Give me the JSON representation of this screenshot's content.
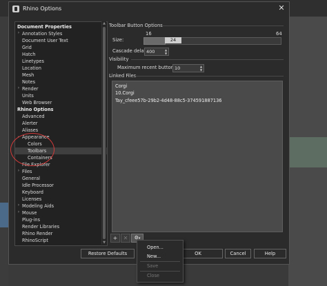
{
  "window": {
    "title": "Rhino Options"
  },
  "tree": {
    "items": [
      {
        "label": "Document Properties",
        "bold": true,
        "indent": 0
      },
      {
        "label": "Annotation Styles",
        "expandable": true,
        "indent": 1
      },
      {
        "label": "Document User Text",
        "indent": 1
      },
      {
        "label": "Grid",
        "indent": 1
      },
      {
        "label": "Hatch",
        "indent": 1
      },
      {
        "label": "Linetypes",
        "indent": 1
      },
      {
        "label": "Location",
        "indent": 1
      },
      {
        "label": "Mesh",
        "indent": 1
      },
      {
        "label": "Notes",
        "indent": 1
      },
      {
        "label": "Render",
        "expandable": true,
        "indent": 1
      },
      {
        "label": "Units",
        "indent": 1
      },
      {
        "label": "Web Browser",
        "indent": 1
      },
      {
        "label": "Rhino Options",
        "bold": true,
        "indent": 0
      },
      {
        "label": "Advanced",
        "indent": 1
      },
      {
        "label": "Alerter",
        "indent": 1
      },
      {
        "label": "Aliases",
        "indent": 1
      },
      {
        "label": "Appearance",
        "expanded": true,
        "indent": 1
      },
      {
        "label": "Colors",
        "indent": 2
      },
      {
        "label": "Toolbars",
        "indent": 2,
        "selected": true
      },
      {
        "label": "Containers",
        "indent": 2
      },
      {
        "label": "File Explorer",
        "indent": 1
      },
      {
        "label": "Files",
        "expandable": true,
        "indent": 1
      },
      {
        "label": "General",
        "indent": 1
      },
      {
        "label": "Idle Processor",
        "indent": 1
      },
      {
        "label": "Keyboard",
        "indent": 1
      },
      {
        "label": "Licenses",
        "indent": 1
      },
      {
        "label": "Modeling Aids",
        "expandable": true,
        "indent": 1
      },
      {
        "label": "Mouse",
        "expandable": true,
        "indent": 1
      },
      {
        "label": "Plug-ins",
        "indent": 1
      },
      {
        "label": "Render Libraries",
        "indent": 1
      },
      {
        "label": "Rhino Render",
        "indent": 1
      },
      {
        "label": "RhinoScript",
        "indent": 1
      }
    ]
  },
  "toolbar_button_options": {
    "group_label": "Toolbar Button Options",
    "size_label": "Size:",
    "size_min": "16",
    "size_max": "64",
    "size_value": "24",
    "cascade_label": "Cascade delay:",
    "cascade_value": "400"
  },
  "visibility": {
    "group_label": "Visibility",
    "max_recent_label": "Maximum recent buttons:",
    "max_recent_value": "10"
  },
  "linked_files": {
    "group_label": "Linked Files",
    "items": [
      "Corgi",
      "10.Corgi",
      "Tay_cfeee57b-29b2-4d48-88c5-374591887136"
    ]
  },
  "list_toolbar": {
    "add": "+",
    "remove": "✕",
    "menu": "⚙"
  },
  "buttons": {
    "restore_defaults": "Restore Defaults",
    "ok": "OK",
    "cancel": "Cancel",
    "help": "Help"
  },
  "context_menu": {
    "items": [
      {
        "label": "Open...",
        "enabled": true
      },
      {
        "label": "New...",
        "enabled": true
      },
      {
        "label": "Save",
        "enabled": false
      },
      {
        "label": "Close",
        "enabled": false
      }
    ]
  },
  "colors": {
    "annotation": "#d43a3a",
    "selection": "#3f3f3f"
  }
}
